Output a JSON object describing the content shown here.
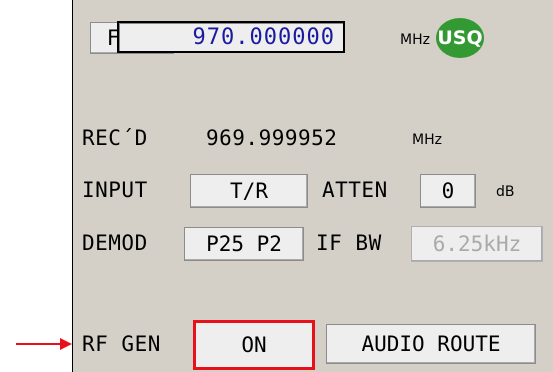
{
  "header": {
    "freq_button": "FREQ",
    "freq_value": "970.000000",
    "freq_unit": "MHz",
    "status_badge": "USQ"
  },
  "received": {
    "label": "REC´D",
    "value": "969.999952",
    "unit": "MHz"
  },
  "input": {
    "label": "INPUT",
    "value": "T/R"
  },
  "attenuation": {
    "label": "ATTEN",
    "value": "0",
    "unit": "dB"
  },
  "demod": {
    "label": "DEMOD",
    "value": "P25 P2"
  },
  "if_bandwidth": {
    "label": "IF BW",
    "value": "6.25kHz"
  },
  "rf_gen": {
    "label": "RF GEN",
    "value": "ON"
  },
  "audio_route": {
    "label": "AUDIO ROUTE"
  },
  "colors": {
    "panel_bg": "#d4d0c8",
    "frequency_text": "#1a1aa0",
    "status_green": "#339933",
    "highlight_red": "#e8101a"
  }
}
